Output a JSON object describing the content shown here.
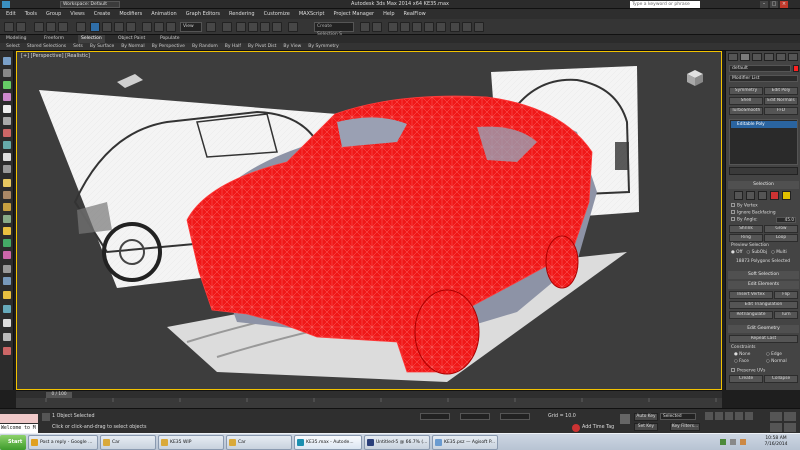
{
  "app": {
    "title": "Autodesk 3ds Max 2014 x64    KE35.max",
    "workspace": "Workspace: Default",
    "search_placeholder": "Type a keyword or phrase"
  },
  "menu": [
    "Edit",
    "Tools",
    "Group",
    "Views",
    "Create",
    "Modifiers",
    "Animation",
    "Graph Editors",
    "Rendering",
    "Customize",
    "MAXScript",
    "Project Manager",
    "Help",
    "RealFlow"
  ],
  "toolbar": {
    "view_dropdown": "View",
    "selection_set": "Create Selection S"
  },
  "ribbon": {
    "tabs": [
      "Modeling",
      "Freeform",
      "Selection",
      "Object Paint",
      "Populate"
    ],
    "active_tab": "Selection",
    "sub_items": [
      "Select",
      "Stored Selections",
      "Sets",
      "By Surface",
      "By Normal",
      "By Perspective",
      "By Random",
      "By Half",
      "By Pivot Dist",
      "By View",
      "By Symmetry"
    ]
  },
  "viewport": {
    "label": "[+] [Perspective] [Realistic]",
    "mesh_color": "#ff1a1a"
  },
  "command_panel": {
    "object_name": "default",
    "modifier_list": "Modifier List",
    "buttons": [
      [
        "Symmetry",
        "Edit Poly"
      ],
      [
        "Shell",
        "Edit Normals"
      ],
      [
        "TurboSmooth",
        "FFD"
      ]
    ],
    "stack_item": "Editable Poly",
    "selection": {
      "heading": "Selection",
      "by_vertex": "By Vertex",
      "ignore_backfacing": "Ignore Backfacing",
      "by_angle": "By Angle:",
      "angle_value": "45.0",
      "shrink": "Shrink",
      "grow": "Grow",
      "ring": "Ring",
      "loop": "Loop",
      "preview_label": "Preview Selection",
      "preview_opts": [
        "Off",
        "SubObj",
        "Multi"
      ],
      "status": "18873 Polygons Selected"
    },
    "soft_selection": "Soft Selection",
    "edit_elements": {
      "heading": "Edit Elements",
      "insert_vertex": "Insert Vertex",
      "flip": "Flip",
      "edit_triangulation": "Edit Triangulation",
      "retriangulate": "Retriangulate",
      "turn": "Turn"
    },
    "edit_geometry": {
      "heading": "Edit Geometry",
      "repeat_last": "Repeat Last",
      "constraints": "Constraints",
      "c_opts": [
        "None",
        "Edge",
        "Face",
        "Normal"
      ],
      "preserve_uvs": "Preserve UVs",
      "create": "Create",
      "collapse": "Collapse",
      "attach": "Attach",
      "detach": "Detach"
    }
  },
  "timeline": {
    "frame": "0 / 100"
  },
  "status": {
    "maxscript": "Welcome to M",
    "objects": "1 Object Selected",
    "prompt": "Click or click-and-drag to select objects",
    "grid": "Grid = 10.0",
    "auto_key": "Auto Key",
    "selected": "Selected",
    "set_key": "Set Key",
    "key_filters": "Key Filters...",
    "add_time_tag": "Add Time Tag"
  },
  "taskbar": {
    "start": "Start",
    "tasks": [
      {
        "label": "Post a reply - Google ...",
        "color": "#e0a020"
      },
      {
        "label": "Car",
        "color": "#d9a93a"
      },
      {
        "label": "KE35 WIP",
        "color": "#d9a93a"
      },
      {
        "label": "Car",
        "color": "#d9a93a"
      },
      {
        "label": "KE35.max - Autode...",
        "color": "#1b8fb0"
      },
      {
        "label": "Untitled-5 @ 66.7% (...",
        "color": "#2a3f7a"
      },
      {
        "label": "KE35.psz — Agisoft P...",
        "color": "#6a9bd0"
      }
    ],
    "time": "10:58 AM",
    "date": "7/16/2014"
  }
}
